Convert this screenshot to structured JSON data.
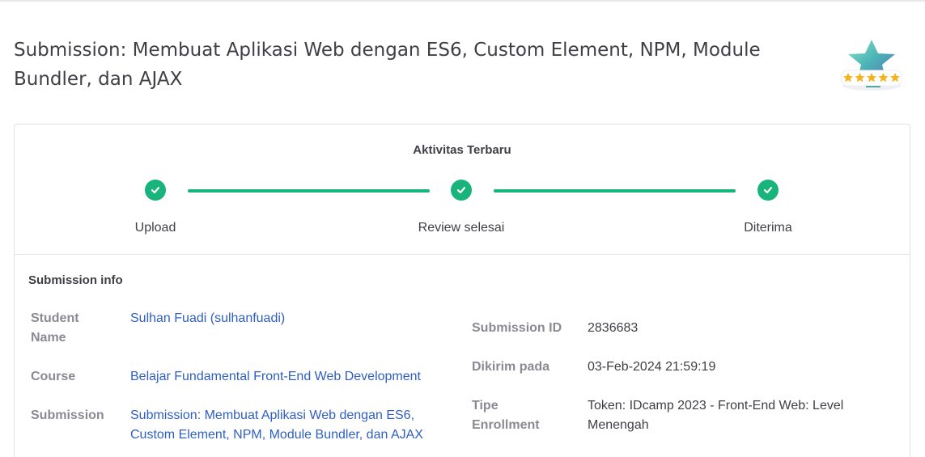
{
  "page": {
    "title": "Submission: Membuat Aplikasi Web dengan ES6, Custom Element, NPM, Module Bundler, dan AJAX"
  },
  "badge": {
    "icon": "star-rating-badge-icon",
    "stars": 5
  },
  "activity": {
    "title": "Aktivitas Terbaru",
    "steps": [
      {
        "label": "Upload",
        "icon": "check-icon"
      },
      {
        "label": "Review selesai",
        "icon": "check-icon"
      },
      {
        "label": "Diterima",
        "icon": "check-icon"
      }
    ]
  },
  "info": {
    "title": "Submission info",
    "student_name_label": "Student Name",
    "student_name_value": "Sulhan Fuadi (sulhanfuadi)",
    "course_label": "Course",
    "course_value": "Belajar Fundamental Front-End Web Development",
    "submission_label": "Submission",
    "submission_value": "Submission: Membuat Aplikasi Web dengan ES6, Custom Element, NPM, Module Bundler, dan AJAX",
    "submission_id_label": "Submission ID",
    "submission_id_value": "2836683",
    "sent_label": "Dikirim pada",
    "sent_value": "03-Feb-2024 21:59:19",
    "enrollment_label": "Tipe Enrollment",
    "enrollment_value": "Token: IDcamp 2023 - Front-End Web: Level Menengah"
  },
  "colors": {
    "accent": "#19b37c",
    "link": "#2f5fc1",
    "label": "#8a8a93",
    "text": "#3f3f46"
  }
}
